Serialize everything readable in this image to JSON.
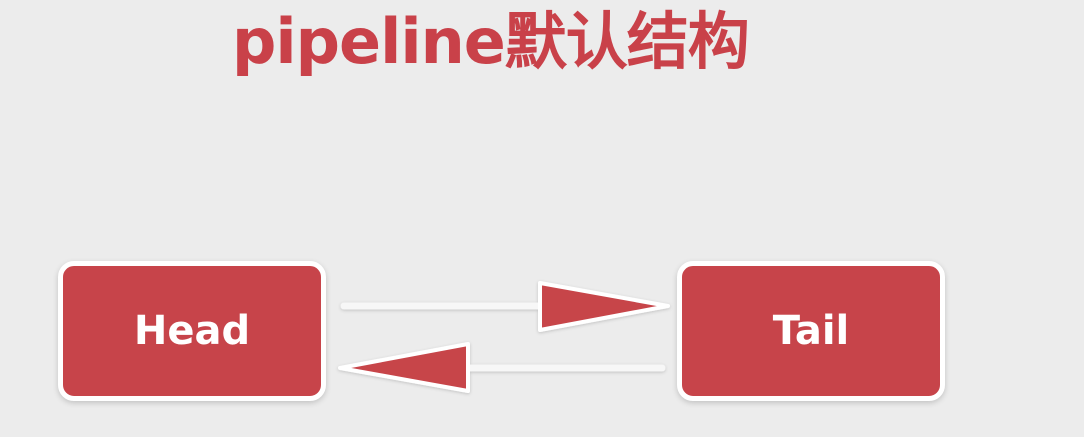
{
  "title": "pipeline默认结构",
  "nodes": {
    "head": "Head",
    "tail": "Tail"
  },
  "colors": {
    "background": "#ececec",
    "title": "#c94149",
    "node_fill": "#c7444a",
    "node_border": "#ffffff",
    "arrow_fill": "#c7444a",
    "arrow_line": "#f7f7f7"
  }
}
